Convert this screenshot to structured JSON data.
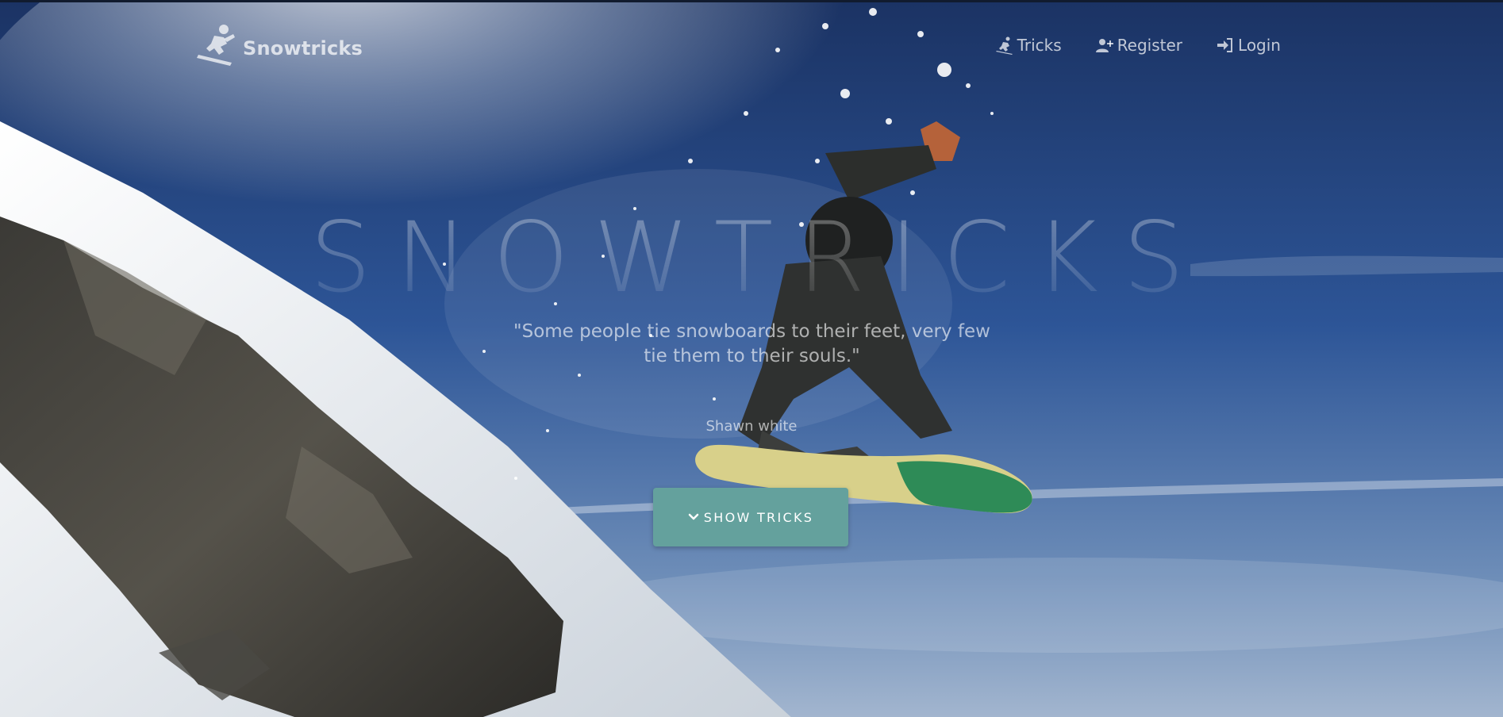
{
  "brand": {
    "name": "Snowtricks",
    "icon": "snowboarder-icon"
  },
  "nav": {
    "items": [
      {
        "label": "Tricks",
        "icon": "snowboarder-icon"
      },
      {
        "label": "Register",
        "icon": "user-plus-icon"
      },
      {
        "label": "Login",
        "icon": "sign-in-icon"
      }
    ]
  },
  "hero": {
    "title": "SNOWTRICKS",
    "quote": "\"Some people tie snowboards to their feet, very few tie them to their souls.\"",
    "author": "Shawn white",
    "button_label": "Show tricks",
    "button_icon": "chevron-down-icon"
  },
  "colors": {
    "accent": "#64a19d",
    "sky": "#1f3f72",
    "text_muted": "rgba(255,255,255,0.72)"
  }
}
